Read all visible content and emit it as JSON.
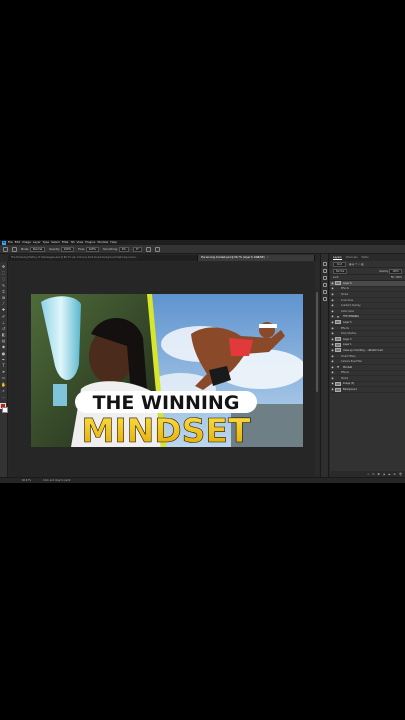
{
  "menubar": {
    "items": [
      "File",
      "Edit",
      "Image",
      "Layer",
      "Type",
      "Select",
      "Filter",
      "3D",
      "View",
      "Plugins",
      "Window",
      "Help"
    ]
  },
  "options": {
    "mode_label": "Mode:",
    "mode_value": "Normal",
    "opacity_label": "Opacity:",
    "opacity_value": "100%",
    "flow_label": "Flow:",
    "flow_value": "100%",
    "smoothing_label": "Smoothing:",
    "smoothing_value": "0%",
    "angle_value": "0°"
  },
  "tabs": [
    {
      "label": "The Drowning History of Volkswagen.psd @ 66.7% (an ominous dark-toned background featuring a lone...",
      "active": false
    },
    {
      "label": "the winning mindset.psd @ 66.7% (Layer 6, RGB/8#)",
      "active": true
    }
  ],
  "status": {
    "zoom": "66.67%",
    "doc_info": "Click and drag to paint"
  },
  "artwork": {
    "line1": "THE WINNING",
    "line2": "MINDSET",
    "accent": "#f5c518",
    "sky": "#7aa9d4"
  },
  "panel": {
    "tabs": [
      "Layers",
      "Channels",
      "Paths"
    ],
    "kind_label": "Kind",
    "blend_mode": "Normal",
    "opacity_label": "Opacity:",
    "opacity_value": "100%",
    "lock_label": "Lock:",
    "fill_label": "Fill:",
    "fill_value": "100%",
    "layers": [
      {
        "name": "Layer 6",
        "type": "image",
        "selected": true
      },
      {
        "name": "Effects",
        "type": "effect"
      },
      {
        "name": "Stroke",
        "type": "effect"
      },
      {
        "name": "Inner Glow",
        "type": "effect"
      },
      {
        "name": "Gradient Overlay",
        "type": "effect"
      },
      {
        "name": "Outer Glow",
        "type": "effect"
      },
      {
        "name": "THE WINNING",
        "type": "text"
      },
      {
        "name": "Layer 5",
        "type": "image"
      },
      {
        "name": "Effects",
        "type": "effect"
      },
      {
        "name": "Drop Shadow",
        "type": "effect"
      },
      {
        "name": "Layer 2",
        "type": "image"
      },
      {
        "name": "Layer 1",
        "type": "image"
      },
      {
        "name": "close-up of smiling ... athletic bust",
        "type": "image"
      },
      {
        "name": "Smart Filters",
        "type": "effect"
      },
      {
        "name": "Camera Raw Filter",
        "type": "effect"
      },
      {
        "name": "Mindset",
        "type": "text"
      },
      {
        "name": "Effects",
        "type": "effect"
      },
      {
        "name": "Stroke",
        "type": "effect"
      },
      {
        "name": "Image (3)",
        "type": "image"
      },
      {
        "name": "Background",
        "type": "image"
      }
    ]
  }
}
